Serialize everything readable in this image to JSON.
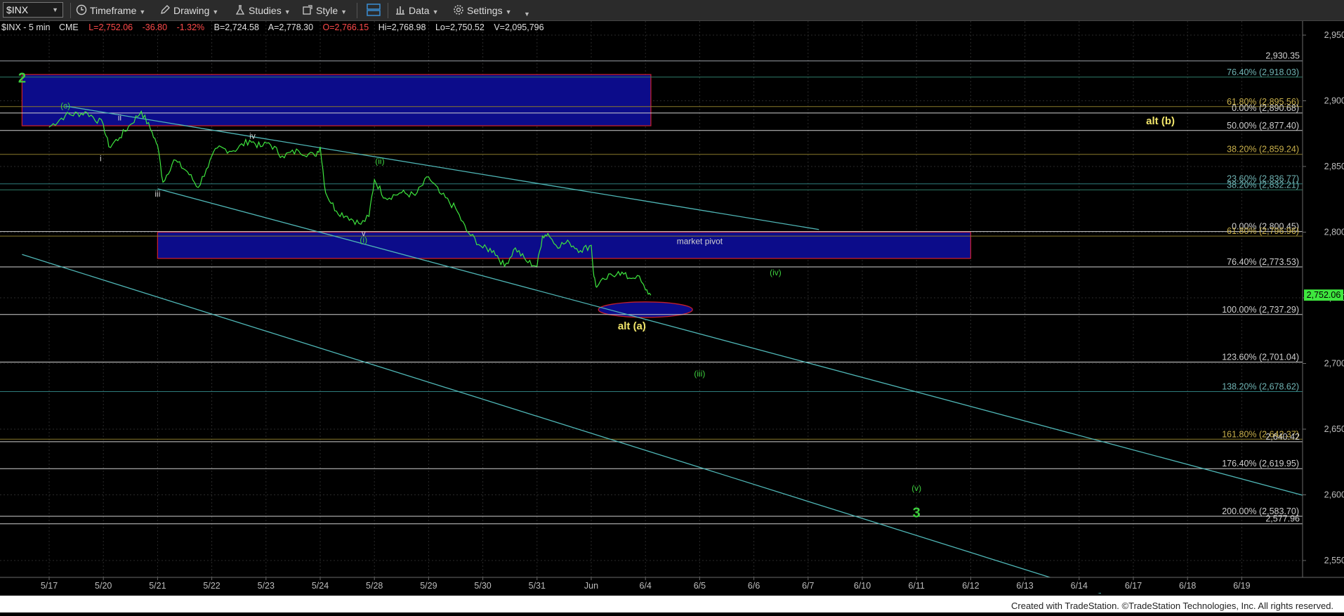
{
  "toolbar": {
    "symbol": "$INX",
    "items": [
      "Timeframe",
      "Drawing",
      "Studies",
      "Style",
      "Data",
      "Settings"
    ]
  },
  "info_bar": {
    "symbol": "$INX - 5 min",
    "exchange": "CME",
    "last": "L=2,752.06",
    "change": "-36.80",
    "pct": "-1.32%",
    "bid": "B=2,724.58",
    "ask": "A=2,778.30",
    "open": "O=2,766.15",
    "high": "Hi=2,768.98",
    "low": "Lo=2,750.52",
    "volume": "V=2,095,796"
  },
  "colors": {
    "background": "#000000",
    "price_line": "#3ee63e",
    "trendline": "#4fb6b6",
    "box_fill": "#0c0c8a",
    "box_border": "#c41f2a",
    "wave_yellow": "#f2e66b",
    "wave_green": "#3ecf3e",
    "axis_text": "#bdbdbd"
  },
  "footer": "Created with TradeStation. ©TradeStation Technologies, Inc. All rights reserved.",
  "chart_data": {
    "type": "line",
    "ylim": [
      2525,
      2965
    ],
    "x_tick_labels": [
      "5/17",
      "5/20",
      "5/21",
      "5/22",
      "5/23",
      "5/24",
      "5/28",
      "5/29",
      "5/30",
      "5/31",
      "Jun",
      "6/4",
      "6/5",
      "6/6",
      "6/7",
      "6/10",
      "6/11",
      "6/12",
      "6/13",
      "6/14",
      "6/17",
      "6/18",
      "6/19"
    ],
    "y_ticks": [
      2550,
      2600,
      2650,
      2700,
      2750,
      2800,
      2850,
      2900,
      2950
    ],
    "y_tick_labels": [
      "2,550.00",
      "2,600.00",
      "2,650.00",
      "2,700.00",
      "2,750.00",
      "2,800.00",
      "2,850.00",
      "2,900.00",
      "2,950.00"
    ],
    "last_price": 2752.06,
    "last_price_label": "2,752.06",
    "series": [
      {
        "values": [
          {
            "x": 0.0,
            "y": 2880
          },
          {
            "x": 0.3,
            "y": 2889
          },
          {
            "x": 0.7,
            "y": 2891
          },
          {
            "x": 1.0,
            "y": 2882
          },
          {
            "x": 1.1,
            "y": 2865
          },
          {
            "x": 1.3,
            "y": 2872
          },
          {
            "x": 1.5,
            "y": 2882
          },
          {
            "x": 1.7,
            "y": 2892
          },
          {
            "x": 1.9,
            "y": 2876
          },
          {
            "x": 2.0,
            "y": 2866
          },
          {
            "x": 2.1,
            "y": 2838
          },
          {
            "x": 2.3,
            "y": 2855
          },
          {
            "x": 2.55,
            "y": 2846
          },
          {
            "x": 2.75,
            "y": 2834
          },
          {
            "x": 2.9,
            "y": 2848
          },
          {
            "x": 3.1,
            "y": 2864
          },
          {
            "x": 3.4,
            "y": 2862
          },
          {
            "x": 3.7,
            "y": 2870
          },
          {
            "x": 3.9,
            "y": 2865
          },
          {
            "x": 4.05,
            "y": 2868
          },
          {
            "x": 4.3,
            "y": 2858
          },
          {
            "x": 4.6,
            "y": 2862
          },
          {
            "x": 4.9,
            "y": 2858
          },
          {
            "x": 5.0,
            "y": 2865
          },
          {
            "x": 5.1,
            "y": 2830
          },
          {
            "x": 5.3,
            "y": 2816
          },
          {
            "x": 5.5,
            "y": 2812
          },
          {
            "x": 5.75,
            "y": 2806
          },
          {
            "x": 5.9,
            "y": 2812
          },
          {
            "x": 6.0,
            "y": 2840
          },
          {
            "x": 6.2,
            "y": 2826
          },
          {
            "x": 6.5,
            "y": 2830
          },
          {
            "x": 6.75,
            "y": 2828
          },
          {
            "x": 7.0,
            "y": 2842
          },
          {
            "x": 7.2,
            "y": 2830
          },
          {
            "x": 7.5,
            "y": 2818
          },
          {
            "x": 7.7,
            "y": 2801
          },
          {
            "x": 8.0,
            "y": 2788
          },
          {
            "x": 8.2,
            "y": 2786
          },
          {
            "x": 8.4,
            "y": 2774
          },
          {
            "x": 8.6,
            "y": 2788
          },
          {
            "x": 8.8,
            "y": 2778
          },
          {
            "x": 9.0,
            "y": 2774
          },
          {
            "x": 9.1,
            "y": 2797
          },
          {
            "x": 9.2,
            "y": 2799
          },
          {
            "x": 9.35,
            "y": 2790
          },
          {
            "x": 9.6,
            "y": 2792
          },
          {
            "x": 9.8,
            "y": 2786
          },
          {
            "x": 10.0,
            "y": 2790
          },
          {
            "x": 10.05,
            "y": 2766
          },
          {
            "x": 10.1,
            "y": 2758
          },
          {
            "x": 10.25,
            "y": 2764
          },
          {
            "x": 10.5,
            "y": 2770
          },
          {
            "x": 10.7,
            "y": 2765
          },
          {
            "x": 10.85,
            "y": 2767
          },
          {
            "x": 11.0,
            "y": 2756
          },
          {
            "x": 11.1,
            "y": 2752
          }
        ]
      }
    ],
    "horizontal_levels": [
      {
        "price": 2930.35,
        "label": "2,930.35",
        "color": "#9aa0a6"
      },
      {
        "price": 2918.03,
        "label": "76.40% (2,918.03)",
        "color": "#2e7d6b"
      },
      {
        "price": 2895.56,
        "label": "61.80% (2,895.56)",
        "color": "#8a7a2a"
      },
      {
        "price": 2890.68,
        "label": "0.00% (2,890.68)",
        "color": "#d0d0d0"
      },
      {
        "price": 2877.4,
        "label": "50.00% (2,877.40)",
        "color": "#d0d0d0"
      },
      {
        "price": 2859.24,
        "label": "38.20% (2,859.24)",
        "color": "#8a7a2a"
      },
      {
        "price": 2836.77,
        "label": "23.60% (2,836.77)",
        "color": "#2e7d7d"
      },
      {
        "price": 2832.21,
        "label": "38.20% (2,832.21)",
        "color": "#2e7d6b"
      },
      {
        "price": 2800.45,
        "label": "0.00% (2,800.45)",
        "color": "#d0d0d0"
      },
      {
        "price": 2796.96,
        "label": "61.80% (2,796.96)",
        "color": "#8a7a2a"
      },
      {
        "price": 2773.53,
        "label": "76.40% (2,773.53)",
        "color": "#d0d0d0"
      },
      {
        "price": 2737.29,
        "label": "100.00% (2,737.29)",
        "color": "#d0d0d0"
      },
      {
        "price": 2701.04,
        "label": "123.60% (2,701.04)",
        "color": "#d0d0d0"
      },
      {
        "price": 2678.62,
        "label": "138.20% (2,678.62)",
        "color": "#2e7d7d"
      },
      {
        "price": 2642.37,
        "label": "161.80% (2,642.37)",
        "color": "#8a7a2a"
      },
      {
        "price": 2640.42,
        "label": "2,640.42",
        "color": "#d0d0d0"
      },
      {
        "price": 2619.95,
        "label": "176.40% (2,619.95)",
        "color": "#d0d0d0"
      },
      {
        "price": 2583.7,
        "label": "200.00% (2,583.70)",
        "color": "#d0d0d0"
      },
      {
        "price": 2577.96,
        "label": "2,577.96",
        "color": "#d0d0d0"
      }
    ],
    "zones": [
      {
        "x1": -0.5,
        "x2": 11.1,
        "y1": 2920,
        "y2": 2881,
        "label": "2"
      },
      {
        "x1": 2.0,
        "x2": 17.0,
        "y1": 2800,
        "y2": 2780,
        "label": "market pivot"
      }
    ],
    "target_ellipse": {
      "x": 11.0,
      "y": 2741
    },
    "trendlines": [
      {
        "x1": 0.3,
        "y1": 2896,
        "x2": 14.2,
        "y2": 2802
      },
      {
        "x1": 2.0,
        "y1": 2833,
        "x2": 24.0,
        "y2": 2590
      },
      {
        "x1": -0.5,
        "y1": 2783,
        "x2": 19.4,
        "y2": 2525
      }
    ],
    "annotations": [
      {
        "text": "2",
        "x": -0.5,
        "y": 2914,
        "color": "#3ecf3e",
        "size": "big"
      },
      {
        "text": "(c)",
        "x": 0.3,
        "y": 2894,
        "color": "#3ecf3e",
        "size": "small"
      },
      {
        "text": "i",
        "x": 0.95,
        "y": 2854,
        "color": "#d0d0d0",
        "size": "small"
      },
      {
        "text": "ii",
        "x": 1.3,
        "y": 2885,
        "color": "#d0d0d0",
        "size": "small"
      },
      {
        "text": "iii",
        "x": 2.0,
        "y": 2827,
        "color": "#d0d0d0",
        "size": "small"
      },
      {
        "text": "iv",
        "x": 3.75,
        "y": 2871,
        "color": "#d0d0d0",
        "size": "small"
      },
      {
        "text": "v",
        "x": 5.8,
        "y": 2797,
        "color": "#d0d0d0",
        "size": "small"
      },
      {
        "text": "(ii)",
        "x": 6.1,
        "y": 2852,
        "color": "#3ecf3e",
        "size": "small"
      },
      {
        "text": "(i)",
        "x": 5.8,
        "y": 2792,
        "color": "#3ecf3e",
        "size": "small"
      },
      {
        "text": "market pivot",
        "x": 12.0,
        "y": 2791,
        "color": "#d0d0d0",
        "size": "small"
      },
      {
        "text": "(iv)",
        "x": 13.4,
        "y": 2767,
        "color": "#3ecf3e",
        "size": "small"
      },
      {
        "text": "alt (a)",
        "x": 10.75,
        "y": 2726,
        "color": "#f2e66b",
        "size": "mid"
      },
      {
        "text": "(iii)",
        "x": 12.0,
        "y": 2690,
        "color": "#3ecf3e",
        "size": "small"
      },
      {
        "text": "alt (b)",
        "x": 20.5,
        "y": 2882,
        "color": "#f2e66b",
        "size": "mid"
      },
      {
        "text": "(v)",
        "x": 16.0,
        "y": 2603,
        "color": "#3ecf3e",
        "size": "small"
      },
      {
        "text": "3",
        "x": 16.0,
        "y": 2583,
        "color": "#3ecf3e",
        "size": "big"
      }
    ]
  }
}
